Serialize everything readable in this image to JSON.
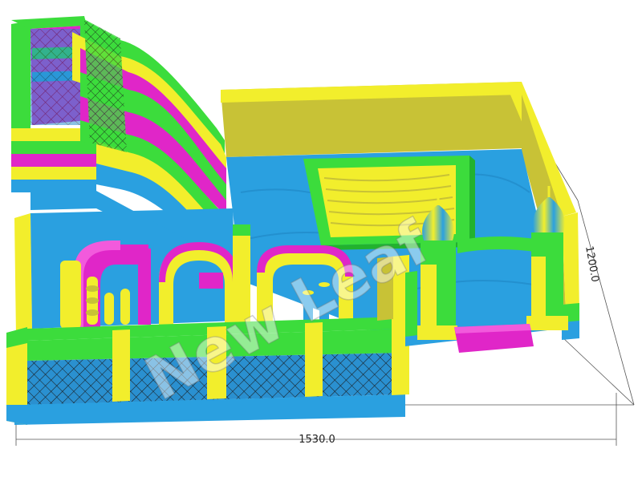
{
  "dimensions": {
    "width_label": "1530.0",
    "depth_label": "1200.0"
  },
  "watermark": "New Leaf",
  "colors": {
    "yellow": "#f2ee2c",
    "yellow_shade": "#b8b23a",
    "green": "#3cdc3c",
    "green_dark": "#22b22e",
    "blue": "#2aa0e0",
    "blue_dark": "#1c7fbe",
    "magenta": "#e026c8",
    "magenta_light": "#f25adc",
    "net": "#222222"
  }
}
